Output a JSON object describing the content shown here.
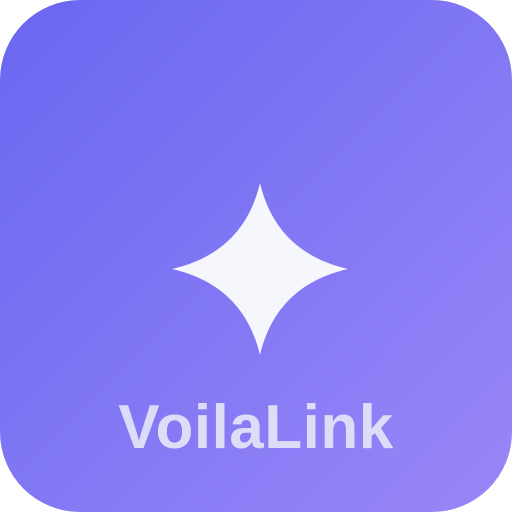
{
  "icon": {
    "app_name": "VoilaLink",
    "symbol": "four-point-sparkle-icon",
    "colors": {
      "gradient_start": "#6a66f1",
      "gradient_end": "#9a87f8",
      "symbol_fill": "#f6f6fd",
      "label_text": "#e4e4f8"
    }
  }
}
